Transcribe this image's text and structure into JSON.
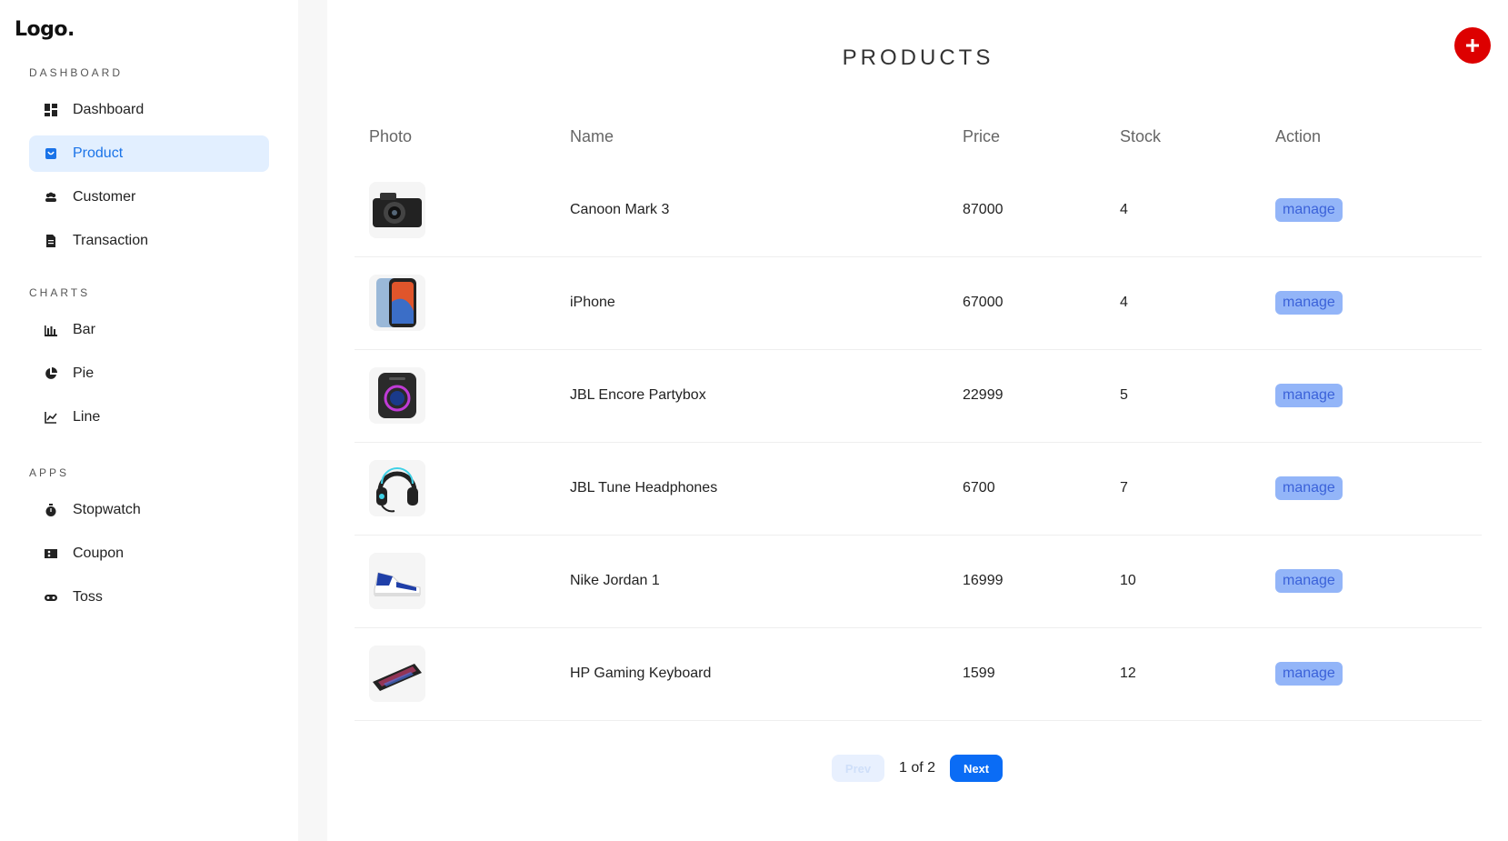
{
  "sidebar": {
    "logo": "Logo.",
    "sections": [
      {
        "title": "DASHBOARD",
        "items": [
          {
            "label": "Dashboard",
            "icon": "dashboard-icon",
            "active": false
          },
          {
            "label": "Product",
            "icon": "shopping-bag-icon",
            "active": true
          },
          {
            "label": "Customer",
            "icon": "users-icon",
            "active": false
          },
          {
            "label": "Transaction",
            "icon": "document-icon",
            "active": false
          }
        ]
      },
      {
        "title": "CHARTS",
        "items": [
          {
            "label": "Bar",
            "icon": "bar-chart-icon"
          },
          {
            "label": "Pie",
            "icon": "pie-chart-icon"
          },
          {
            "label": "Line",
            "icon": "line-chart-icon"
          }
        ]
      },
      {
        "title": "APPS",
        "items": [
          {
            "label": "Stopwatch",
            "icon": "stopwatch-icon"
          },
          {
            "label": "Coupon",
            "icon": "coupon-icon"
          },
          {
            "label": "Toss",
            "icon": "gamepad-icon"
          }
        ]
      }
    ]
  },
  "main": {
    "title": "PRODUCTS",
    "add_icon": "plus-icon",
    "accent_color": "#dd0000",
    "columns": [
      "Photo",
      "Name",
      "Price",
      "Stock",
      "Action"
    ],
    "rows": [
      {
        "photo": "camera-image",
        "name": "Canoon Mark 3",
        "price": "87000",
        "stock": "4",
        "action": "manage"
      },
      {
        "photo": "phone-image",
        "name": "iPhone",
        "price": "67000",
        "stock": "4",
        "action": "manage"
      },
      {
        "photo": "speaker-image",
        "name": "JBL Encore Partybox",
        "price": "22999",
        "stock": "5",
        "action": "manage"
      },
      {
        "photo": "headphones-image",
        "name": "JBL Tune Headphones",
        "price": "6700",
        "stock": "7",
        "action": "manage"
      },
      {
        "photo": "sneaker-image",
        "name": "Nike Jordan 1",
        "price": "16999",
        "stock": "10",
        "action": "manage"
      },
      {
        "photo": "keyboard-image",
        "name": "HP Gaming Keyboard",
        "price": "1599",
        "stock": "12",
        "action": "manage"
      }
    ],
    "pagination": {
      "prev": "Prev",
      "info": "1 of 2",
      "next": "Next"
    }
  }
}
